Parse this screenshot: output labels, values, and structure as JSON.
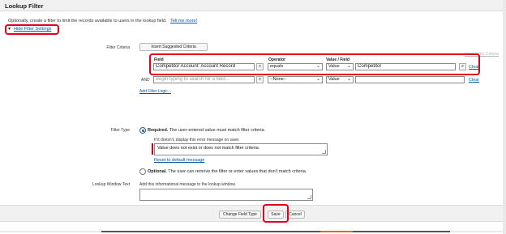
{
  "header": {
    "title": "Lookup Filter"
  },
  "intro": {
    "text": "Optionally, create a filter to limit the records available to users in the lookup field.",
    "link": "Tell me more!"
  },
  "hide_settings": {
    "label": "Hide Filter Settings"
  },
  "criteria": {
    "label": "Filter Criteria",
    "insert_button": "Insert Suggested Criteria",
    "clear_all": "Clear Filter Criteria",
    "col_field": "Field",
    "col_operator": "Operator",
    "col_value": "Value / Field",
    "row1": {
      "field": "Competitor Account: Account Record",
      "operator": "equals",
      "value_type": "Value",
      "value": "Competitor",
      "clear": "Clear"
    },
    "row2": {
      "and": "AND",
      "field_placeholder": "Begin typing to search for a field...",
      "operator": "--None--",
      "value_type": "Value",
      "clear": "Clear"
    },
    "add_logic": "Add Filter Logic..."
  },
  "filter_type": {
    "label": "Filter Type",
    "required_bold": "Required.",
    "required_rest": "The user-entered value must match filter criteria.",
    "error_prompt": "If it doesn't, display this error message on save:",
    "error_message": "Value does not exist or does not match filter criteria.",
    "reset_link": "Reset to default message",
    "optional_bold": "Optional.",
    "optional_rest": "The user can remove the filter or enter values that don't match criteria."
  },
  "lookup_window": {
    "label": "Lookup Window Text",
    "prompt": "Add this informational message to the lookup window."
  },
  "active": {
    "label": "Active",
    "checkbox_label": "Enable this filter."
  },
  "footer": {
    "change_field_type": "Change Field Type",
    "save": "Save",
    "cancel": "Cancel"
  },
  "colors": {
    "accent": "#015ba7",
    "highlight": "#e3001b",
    "checkbox": "#1b6ec4"
  }
}
